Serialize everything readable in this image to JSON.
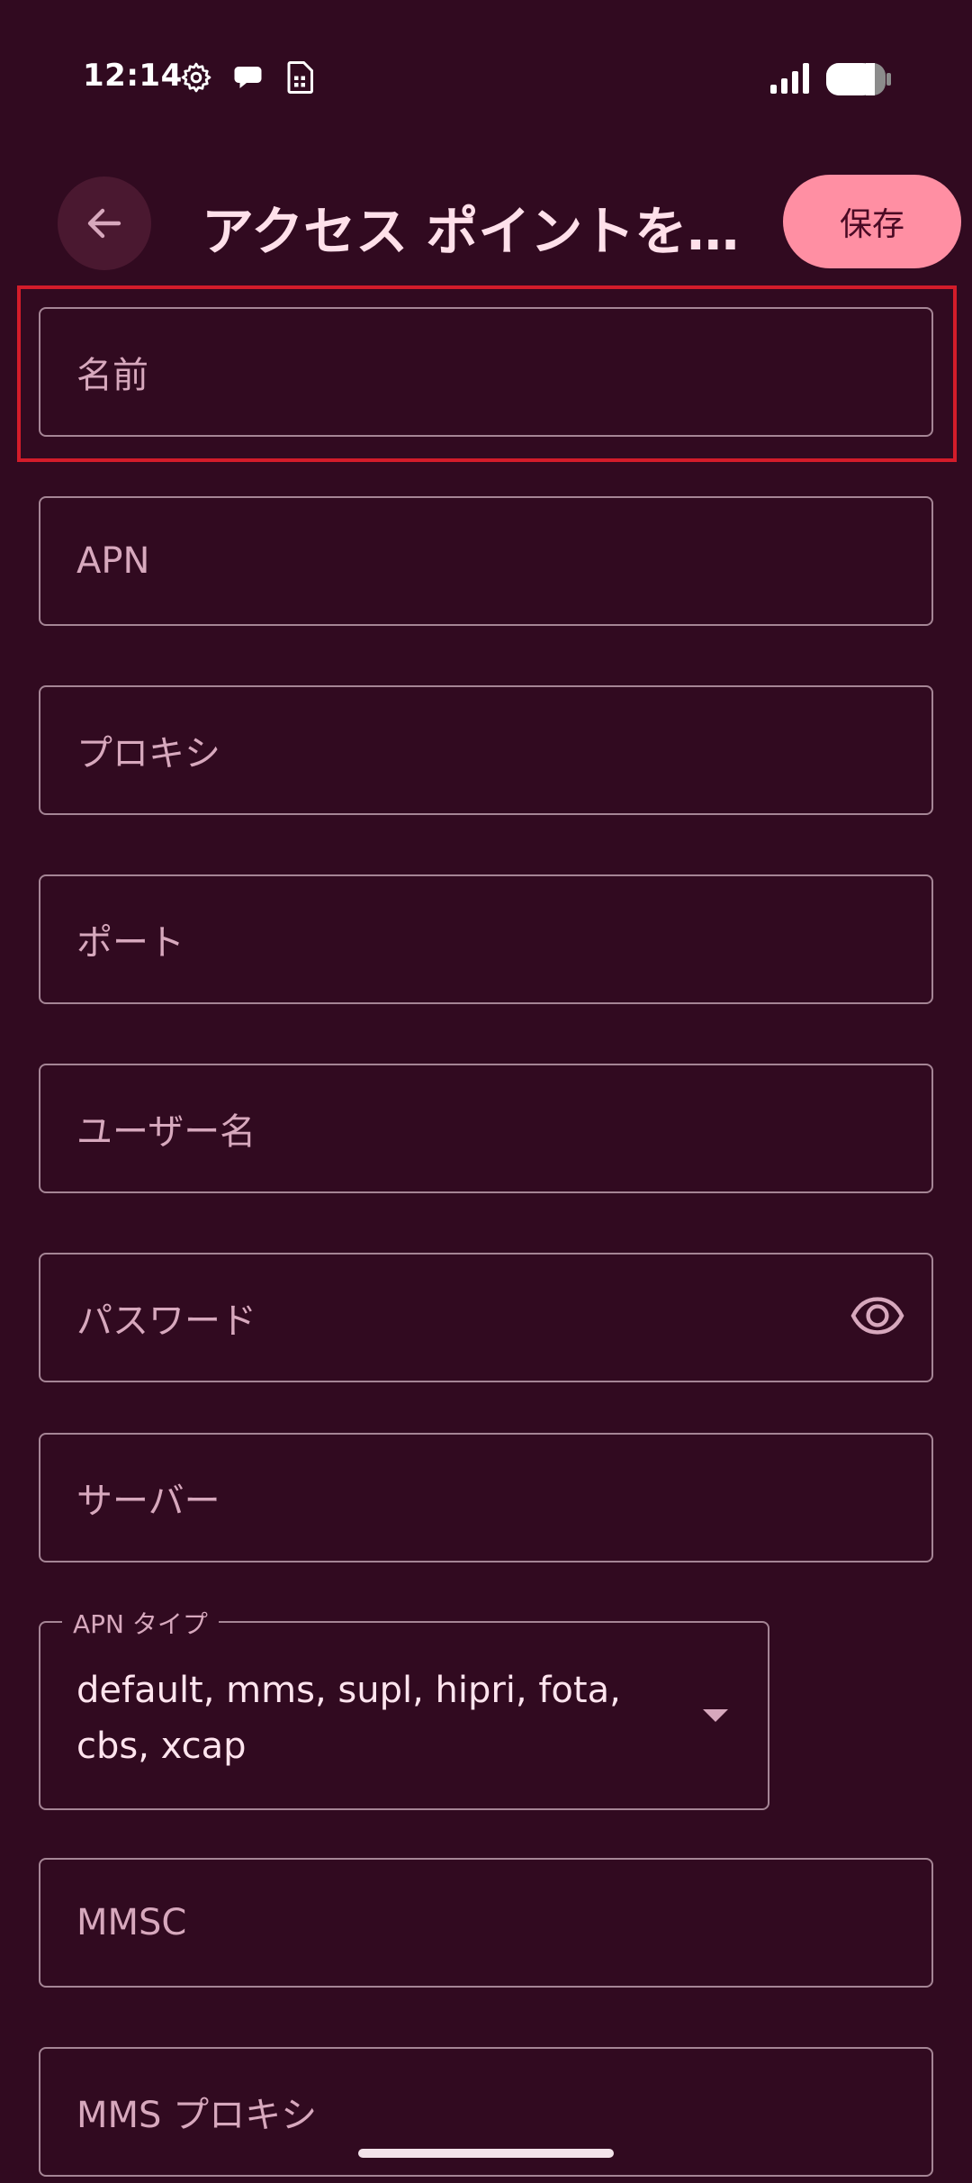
{
  "status_bar": {
    "time": "12:14",
    "icons": [
      "settings-gear-icon",
      "chat-bubble-icon",
      "sim-card-icon",
      "signal-icon",
      "battery-icon"
    ]
  },
  "app_bar": {
    "back_icon": "arrow-back-icon",
    "title": "アクセス ポイントを…",
    "save_label": "保存"
  },
  "fields": {
    "name": "名前",
    "apn": "APN",
    "proxy": "プロキシ",
    "port": "ポート",
    "username": "ユーザー名",
    "password": "パスワード",
    "server": "サーバー",
    "mmsc": "MMSC",
    "mms_proxy": "MMS プロキシ"
  },
  "apn_type": {
    "label": "APN タイプ",
    "value": "default, mms, supl, hipri, fota, cbs, xcap"
  },
  "colors": {
    "background": "#310a20",
    "accent": "#ff8fa3",
    "highlight": "#d31c2a"
  }
}
